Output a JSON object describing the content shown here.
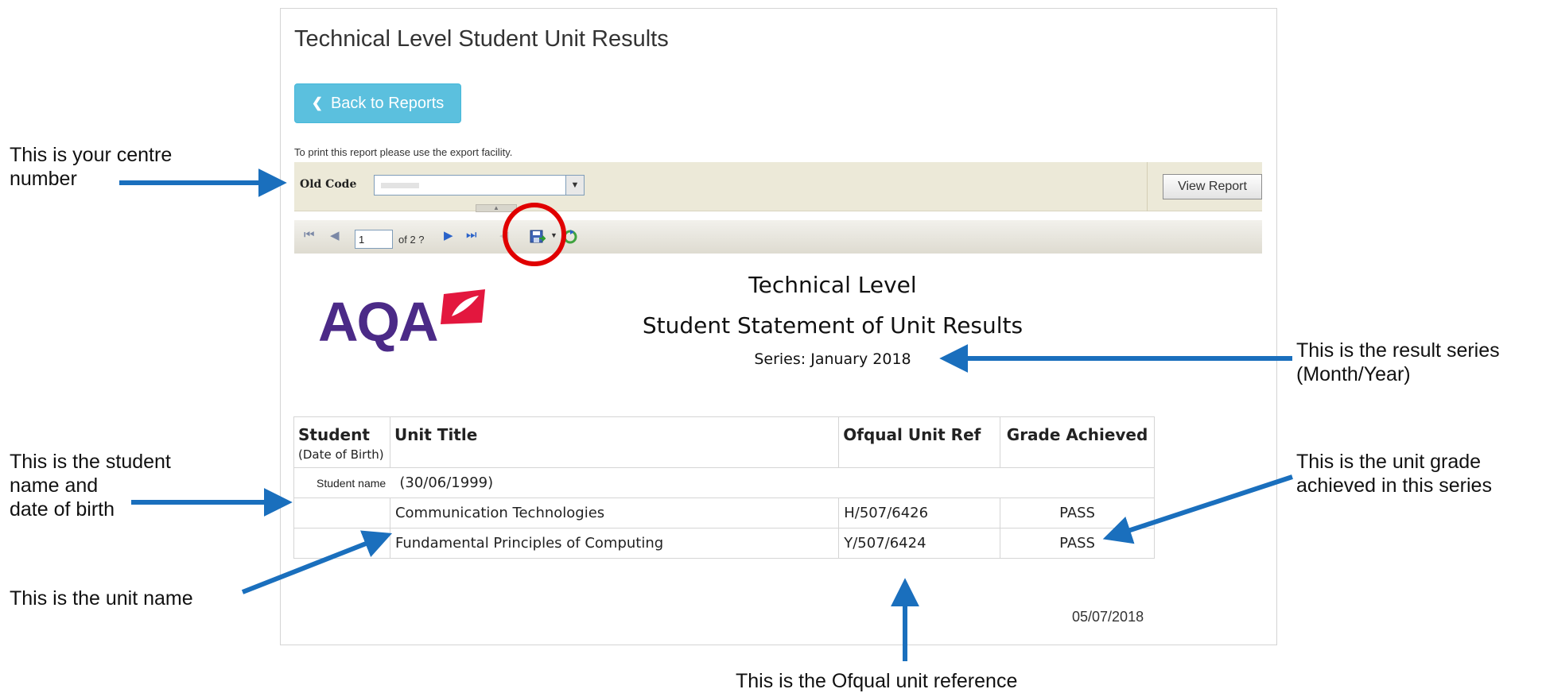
{
  "page": {
    "title": "Technical Level Student Unit Results",
    "back_button": "Back to Reports",
    "print_note": "To print this report please use the export facility."
  },
  "params": {
    "old_code_label": "Old Code",
    "view_report_button": "View Report"
  },
  "toolbar": {
    "current_page": "1",
    "of_pages": "of 2 ?"
  },
  "report": {
    "logo_text": "AQA",
    "title_line1": "Technical Level",
    "title_line2": "Student Statement of Unit Results",
    "series": "Series: January 2018",
    "headers": {
      "student": "Student",
      "student_sub": "(Date of Birth)",
      "unit_title": "Unit Title",
      "unit_ref": "Ofqual Unit Ref",
      "grade": "Grade Achieved"
    },
    "student_name": "Student name",
    "student_dob": "(30/06/1999)",
    "rows": [
      {
        "title": "Communication Technologies",
        "ref": "H/507/6426",
        "grade": "PASS"
      },
      {
        "title": "Fundamental Principles of Computing",
        "ref": "Y/507/6424",
        "grade": "PASS"
      }
    ],
    "date": "05/07/2018"
  },
  "annotations": {
    "centre_line1": "This is your centre",
    "centre_line2": "number",
    "student_line1": "This is the student",
    "student_line2": "name and",
    "student_line3": "date of birth",
    "unit_name": "This is the unit name",
    "series_line1": "This is the result series",
    "series_line2": "(Month/Year)",
    "grade_line1": "This is the unit grade",
    "grade_line2": "achieved in this series",
    "ofqual": "This is the Ofqual unit reference"
  },
  "colors": {
    "arrow": "#1a6fbd",
    "highlight_circle": "#e00000",
    "button": "#5bc0de",
    "brand": "#4b2a87",
    "brand_mark": "#e3173e"
  }
}
